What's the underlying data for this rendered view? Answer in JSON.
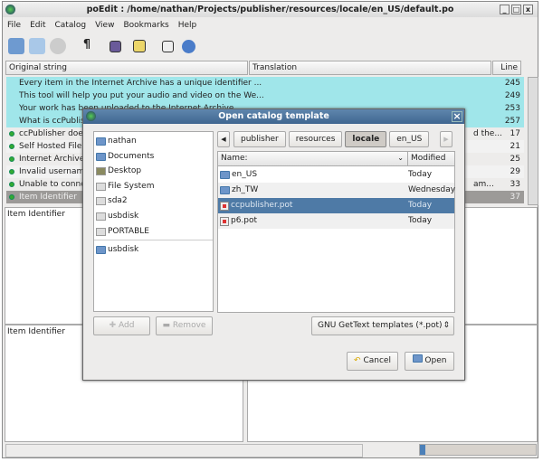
{
  "window": {
    "title": "poEdit : /home/nathan/Projects/publisher/resources/locale/en_US/default.po",
    "min": "_",
    "max": "□",
    "close": "x"
  },
  "menu": [
    "File",
    "Edit",
    "Catalog",
    "View",
    "Bookmarks",
    "Help"
  ],
  "toolbar": [
    "open-icon",
    "save-icon",
    "update-icon",
    "pilcrow-icon",
    "fuzzy-icon",
    "comment-icon",
    "settings-icon",
    "help-icon"
  ],
  "pilcrow": "¶",
  "columns": {
    "original": "Original string",
    "translation": "Translation",
    "line": "Line"
  },
  "rows": [
    {
      "text": "Every item in the Internet Archive has a unique identifier ...",
      "trans": "",
      "line": "245",
      "state": "untranslated"
    },
    {
      "text": "This tool will help you put your audio and video on the We...",
      "trans": "",
      "line": "249",
      "state": "untranslated"
    },
    {
      "text": "Your work has been uploaded to the Internet Archive",
      "trans": "",
      "line": "253",
      "state": "untranslated"
    },
    {
      "text": "What is ccPublisher?",
      "trans": "",
      "line": "257",
      "state": "untranslated"
    },
    {
      "text": "ccPublisher does",
      "trans": "d the...",
      "line": "17",
      "state": "done"
    },
    {
      "text": "Self Hosted Files",
      "trans": "",
      "line": "21",
      "state": "done"
    },
    {
      "text": "Internet Archive",
      "trans": "",
      "line": "25",
      "state": "done"
    },
    {
      "text": "Invalid username",
      "trans": "",
      "line": "29",
      "state": "done"
    },
    {
      "text": "Unable to conne",
      "trans": "am...",
      "line": "33",
      "state": "done"
    },
    {
      "text": "Item Identifier",
      "trans": "",
      "line": "37",
      "state": "selected"
    }
  ],
  "source_pane": "Item Identifier",
  "comment_pane": "Item Identifier",
  "colors": {
    "untranslated": "#a0e6ea",
    "selected": "#9c9a98",
    "dialog_title": "#4a719a",
    "file_selected": "#4e7aa6"
  },
  "dialog": {
    "title": "Open catalog template",
    "close": "×",
    "places": [
      {
        "label": "nathan",
        "icon": "home-folder-icon"
      },
      {
        "label": "Documents",
        "icon": "folder-icon"
      },
      {
        "label": "Desktop",
        "icon": "desktop-icon"
      },
      {
        "label": "File System",
        "icon": "drive-icon"
      },
      {
        "label": "sda2",
        "icon": "drive-icon"
      },
      {
        "label": "usbdisk",
        "icon": "drive-icon"
      },
      {
        "label": "PORTABLE",
        "icon": "drive-icon"
      }
    ],
    "bookmarks": [
      {
        "label": "usbdisk",
        "icon": "folder-icon"
      }
    ],
    "path": [
      "publisher",
      "resources",
      "locale",
      "en_US"
    ],
    "active_path": "locale",
    "file_headers": {
      "name": "Name:",
      "modified": "Modified"
    },
    "files": [
      {
        "name": "en_US",
        "modified": "Today",
        "type": "folder"
      },
      {
        "name": "zh_TW",
        "modified": "Wednesday",
        "type": "folder"
      },
      {
        "name": "ccpublisher.pot",
        "modified": "Today",
        "type": "pot",
        "selected": true
      },
      {
        "name": "p6.pot",
        "modified": "Today",
        "type": "pot"
      }
    ],
    "add": "Add",
    "remove": "Remove",
    "filter": "GNU GetText templates (*.pot)",
    "cancel": "Cancel",
    "open": "Open"
  },
  "progress": 0.05
}
